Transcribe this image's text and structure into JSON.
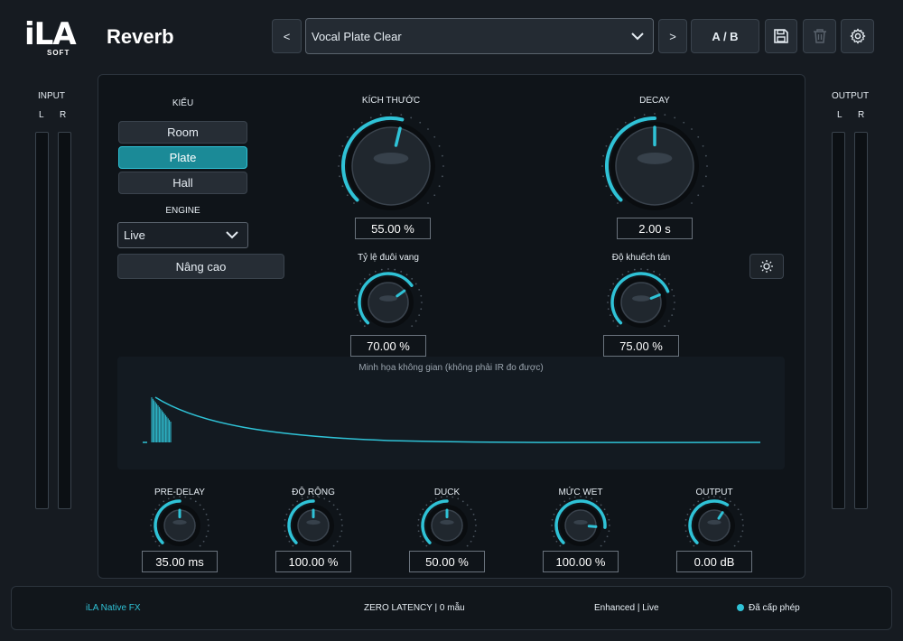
{
  "brand": {
    "logo_main": "iLA",
    "logo_sub": "SOFT"
  },
  "header": {
    "plugin_name": "Reverb",
    "prev_label": "<",
    "next_label": ">",
    "preset_name": "Vocal Plate Clear",
    "ab_label": "A / B",
    "icons": [
      "chevron-down-icon",
      "save-icon",
      "trash-icon",
      "gear-icon"
    ]
  },
  "meters": {
    "input_label": "INPUT",
    "output_label": "OUTPUT",
    "left": "L",
    "right": "R"
  },
  "type_section": {
    "label": "KIỂU",
    "options": [
      "Room",
      "Plate",
      "Hall"
    ],
    "selected": "Plate"
  },
  "engine": {
    "label": "ENGINE",
    "value": "Live",
    "advanced_label": "Nâng cao"
  },
  "knobs": {
    "size": {
      "label": "KÍCH THƯỚC",
      "value": "55.00 %",
      "level": 0.55
    },
    "decay": {
      "label": "DECAY",
      "value": "2.00 s",
      "level": 0.5
    },
    "tail_ratio": {
      "label": "Tỷ lệ đuôi vang",
      "value": "70.00 %",
      "level": 0.7
    },
    "diffusion": {
      "label": "Độ khuếch tán",
      "value": "75.00 %",
      "level": 0.75
    },
    "pre_delay": {
      "label": "PRE-DELAY",
      "value": "35.00 ms",
      "level": 0.5
    },
    "width": {
      "label": "ĐỘ RỘNG",
      "value": "100.00 %",
      "level": 0.5
    },
    "duck": {
      "label": "DUCK",
      "value": "50.00 %",
      "level": 0.5
    },
    "wet": {
      "label": "MỨC WET",
      "value": "100.00 %",
      "level": 0.85
    },
    "output": {
      "label": "OUTPUT",
      "value": "0.00 dB",
      "level": 0.62
    }
  },
  "visualizer": {
    "caption": "Minh họa không gian (không phải IR đo được)"
  },
  "footer": {
    "brand": "iLA  Native FX",
    "latency": "ZERO LATENCY   |   0 mẫu",
    "mode": "Enhanced | Live",
    "license": "Đã cấp phép"
  },
  "colors": {
    "accent": "#2fc2d6",
    "active_button": "#1b8a97",
    "background": "#161b21",
    "panel": "#0f1419"
  }
}
